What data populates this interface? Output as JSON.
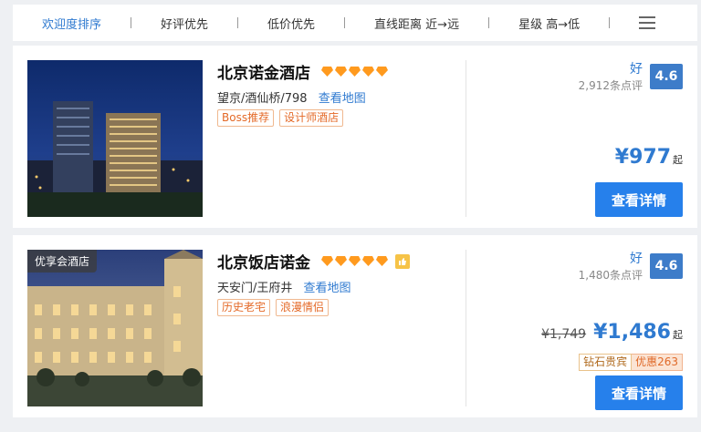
{
  "sortbar": {
    "items": [
      "欢迎度排序",
      "好评优先",
      "低价优先",
      "直线距离 近→远",
      "星级 高→低"
    ],
    "active_index": 0,
    "menu_icon": "menu-icon"
  },
  "hotels": [
    {
      "name": "北京诺金酒店",
      "diamonds": 5,
      "location": "望京/酒仙桥/798",
      "map_link": "查看地图",
      "tags": [
        "Boss推荐",
        "设计师酒店"
      ],
      "score_label": "好",
      "review_count": "2,912条点评",
      "score": "4.6",
      "price": "¥977",
      "price_suffix": "起",
      "detail_button": "查看详情"
    },
    {
      "name": "北京饭店诺金",
      "diamonds": 5,
      "has_thumb_badge": true,
      "photo_badge": "优享会酒店",
      "location": "天安门/王府井",
      "map_link": "查看地图",
      "tags": [
        "历史老宅",
        "浪漫情侣"
      ],
      "score_label": "好",
      "review_count": "1,480条点评",
      "score": "4.6",
      "old_price": "¥1,749",
      "price": "¥1,486",
      "price_suffix": "起",
      "promo_label": "钻石贵宾",
      "promo_value": "优惠263",
      "detail_button": "查看详情"
    }
  ],
  "colors": {
    "accent": "#2f7ad0",
    "button": "#2680eb",
    "diamond": "#ff9a1e",
    "tag": "#e46a28"
  }
}
